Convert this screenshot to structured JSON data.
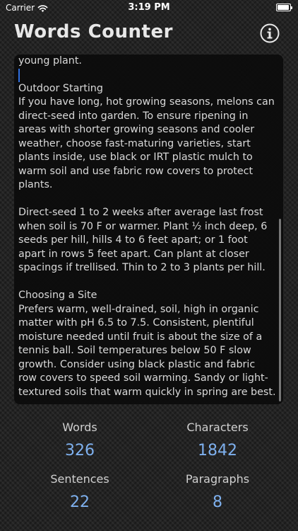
{
  "status_bar": {
    "carrier": "Carrier",
    "time": "3:19 PM",
    "battery": 1.0
  },
  "header": {
    "title": "Words Counter",
    "info_icon": "info-icon"
  },
  "editor": {
    "lines": [
      "young plant.",
      "",
      "Outdoor Starting",
      "If you have long, hot growing seasons, melons can",
      "direct-seed into garden. To ensure ripening in",
      "areas with shorter growing seasons and cooler",
      "weather, choose fast-maturing varieties, start",
      "plants inside, use black or IRT plastic mulch to",
      "warm soil and use fabric row covers to protect",
      "plants.",
      "",
      "Direct-seed 1 to 2 weeks after average last frost",
      "when soil is 70 F or warmer. Plant ½ inch deep, 6",
      "seeds per hill, hills 4 to 6 feet apart; or 1 foot",
      "apart in rows 5 feet apart. Can plant at closer",
      "spacings if trellised. Thin to 2 to 3 plants per hill.",
      "",
      "Choosing a Site",
      "Prefers warm, well-drained, soil, high in organic",
      "matter with pH 6.5 to 7.5. Consistent, plentiful",
      "moisture needed until fruit is about the size of a",
      "tennis ball. Soil temperatures below 50 F slow",
      "growth. Consider using black plastic and fabric",
      "row covers to speed soil warming. Sandy or light-",
      "textured soils that warm quickly in spring are best."
    ]
  },
  "stats": {
    "words": {
      "label": "Words",
      "value": "326"
    },
    "characters": {
      "label": "Characters",
      "value": "1842"
    },
    "sentences": {
      "label": "Sentences",
      "value": "22"
    },
    "paragraphs": {
      "label": "Paragraphs",
      "value": "8"
    }
  },
  "colors": {
    "accent": "#7eb0ee",
    "cursor": "#2f6fe0"
  }
}
